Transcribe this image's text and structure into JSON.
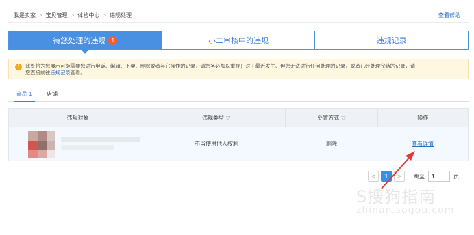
{
  "breadcrumb": {
    "items": [
      "我是卖家",
      "宝贝管理",
      "体检中心",
      "违规处理"
    ],
    "sep": ">",
    "help": "查看帮助"
  },
  "tabs": [
    {
      "label": "待您处理的违规",
      "badge": "1",
      "active": true
    },
    {
      "label": "小二审核中的违规"
    },
    {
      "label": "违规记录"
    }
  ],
  "notice": {
    "icon": "warning-icon",
    "text1": "此处将为您展示可能需要您进行申诉、编辑、下架、删除或者其它操作的记录，请您务必加以重视；对于最近发生、但您无法进行任何处理的记录，或者已经处理完结的记录，请",
    "text2": "您直接前往",
    "link": "违规记录",
    "text3": "查看。"
  },
  "subtabs": [
    {
      "label": "商品 1",
      "active": true
    },
    {
      "label": "店铺"
    }
  ],
  "table": {
    "headers": [
      "违规对象",
      "违规类型",
      "处置方式",
      "操作"
    ],
    "row": {
      "type": "不当使用他人权利",
      "method": "删除",
      "action": "查看详情"
    }
  },
  "pager": {
    "prev": "<",
    "current": "1",
    "next": ">",
    "goto_label": "跳至",
    "page_value": "1",
    "page_unit": "页"
  },
  "watermark": {
    "line1": "S搜狗指南",
    "line2": "zhinan.sogou.com"
  },
  "colors": {
    "accent": "#4a90e2",
    "badge": "#ff5a2a",
    "arrow": "#e53935",
    "notice_bg": "#fff7e0"
  }
}
